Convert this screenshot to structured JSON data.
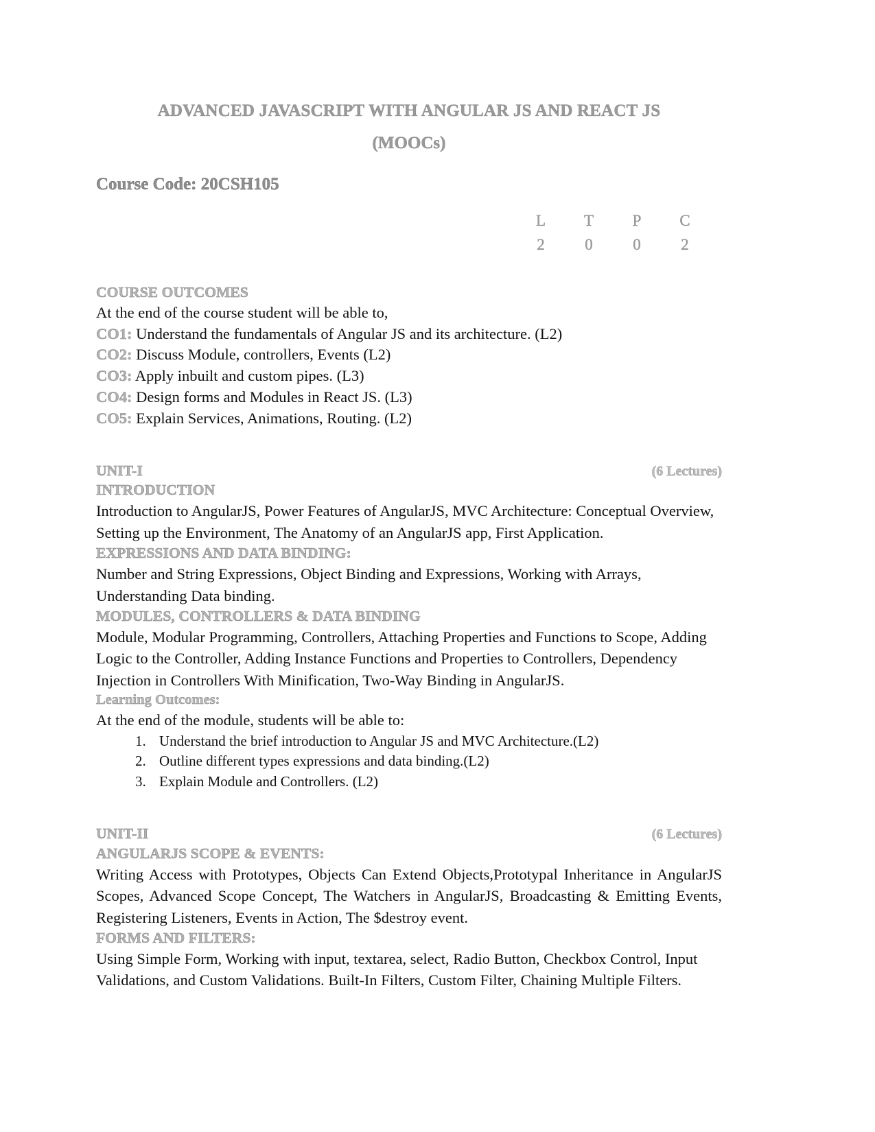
{
  "document": {
    "title": "ADVANCED JAVASCRIPT WITH ANGULAR JS AND REACT JS",
    "subtitle": "(MOOCs)",
    "course_code": "Course Code: 20CSH105"
  },
  "ltpc": {
    "headers": [
      "L",
      "T",
      "P",
      "C"
    ],
    "values": [
      "2",
      "0",
      "0",
      "2"
    ]
  },
  "course_outcomes": {
    "heading": "COURSE OUTCOMES",
    "intro": "At the end of the course student will be able to,",
    "items": [
      {
        "tag": "CO1:",
        "text": " Understand the fundamentals of Angular JS and its architecture. (L2)"
      },
      {
        "tag": "CO2:",
        "text": " Discuss Module, controllers, Events (L2)"
      },
      {
        "tag": "CO3:",
        "text": " Apply inbuilt and custom pipes. (L3)"
      },
      {
        "tag": "CO4:",
        "text": " Design forms and Modules in React JS. (L3)"
      },
      {
        "tag": "CO5:",
        "text": " Explain Services, Animations, Routing. (L2)"
      }
    ]
  },
  "unit1": {
    "label": "UNIT-I",
    "lectures": "(6 Lectures)",
    "section1_heading": "INTRODUCTION",
    "section1_text": "Introduction to AngularJS, Power Features of AngularJS, MVC Architecture: Conceptual Overview, Setting up the Environment, The Anatomy of an AngularJS app,  First Application.",
    "section2_heading": "EXPRESSIONS AND DATA BINDING:",
    "section2_text": "Number and String Expressions, Object Binding and Expressions, Working with Arrays, Understanding Data binding.",
    "section3_heading": "MODULES, CONTROLLERS & DATA BINDING",
    "section3_text": "Module, Modular Programming, Controllers, Attaching Properties and Functions to Scope, Adding Logic to the Controller, Adding Instance Functions and Properties to Controllers, Dependency Injection in Controllers With Minification, Two-Way Binding in AngularJS.",
    "learning_outcomes_heading": "Learning Outcomes:",
    "learning_outcomes_intro": "At the end of the module, students will be able to:",
    "learning_outcomes": [
      "Understand the brief introduction to Angular JS and MVC Architecture.(L2)",
      "Outline different types expressions and data binding.(L2)",
      "Explain Module and Controllers. (L2)"
    ]
  },
  "unit2": {
    "label": "UNIT-II",
    "lectures": "(6 Lectures)",
    "section1_heading": "ANGULARJS SCOPE & EVENTS:",
    "section1_text": "Writing Access with Prototypes, Objects Can Extend Objects,Prototypal Inheritance in AngularJS Scopes, Advanced Scope Concept, The Watchers in AngularJS, Broadcasting & Emitting Events, Registering Listeners, Events in Action, The $destroy event.",
    "section2_heading": "FORMS AND FILTERS:",
    "section2_text": "Using Simple Form, Working with input, textarea, select, Radio Button, Checkbox Control, Input Validations, and Custom Validations. Built-In Filters, Custom Filter, Chaining Multiple Filters."
  }
}
